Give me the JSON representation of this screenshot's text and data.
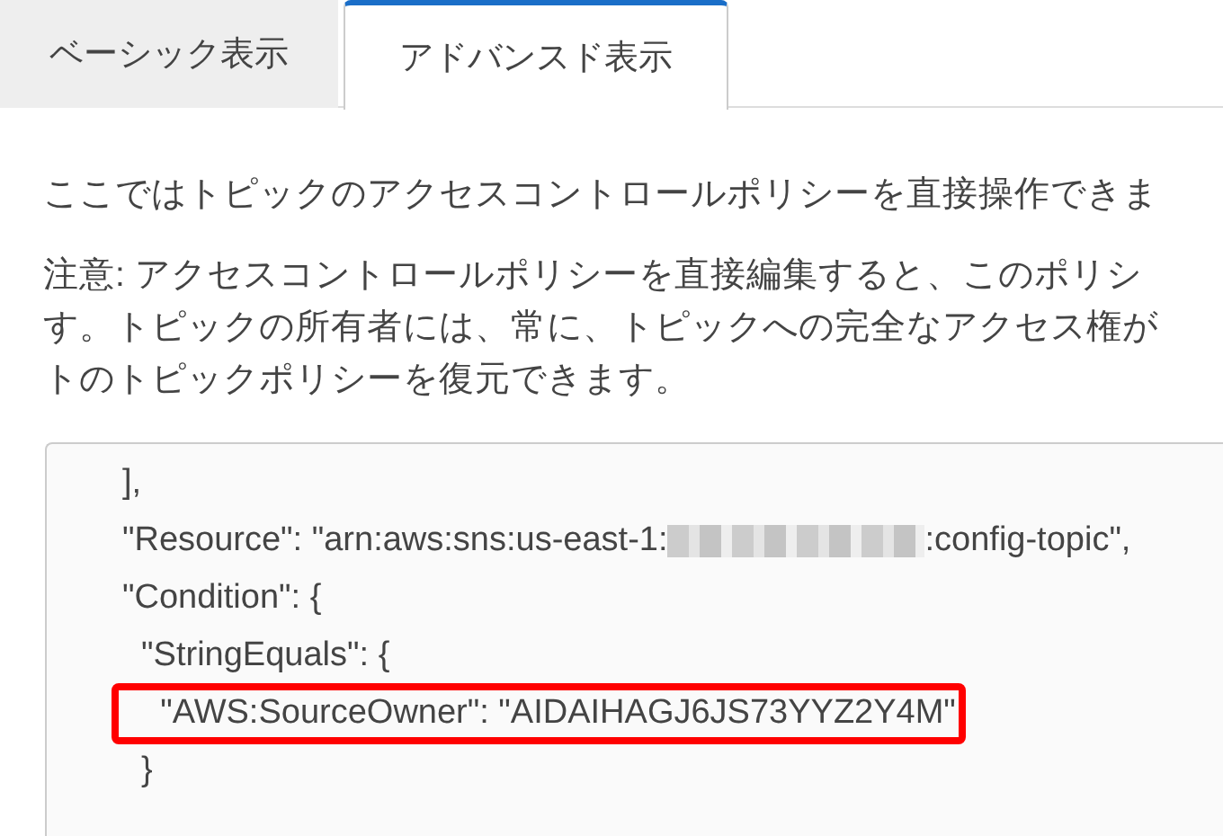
{
  "tabs": [
    {
      "label": "ベーシック表示",
      "selected": false
    },
    {
      "label": "アドバンスド表示",
      "selected": true
    }
  ],
  "intro": "ここではトピックのアクセスコントロールポリシーを直接操作できま",
  "note_lines": [
    "注意: アクセスコントロールポリシーを直接編集すると、このポリシ",
    "す。トピックの所有者には、常に、トピックへの完全なアクセス権が",
    "トのトピックポリシーを復元できます。"
  ],
  "policy_lines": [
    {
      "highlighted": false,
      "parts": [
        {
          "kind": "text",
          "text": "],"
        }
      ]
    },
    {
      "highlighted": false,
      "parts": [
        {
          "kind": "text",
          "text": "\"Resource\": \"arn:aws:sns:us-east-1:"
        },
        {
          "kind": "redacted"
        },
        {
          "kind": "text",
          "text": ":config-topic\","
        }
      ]
    },
    {
      "highlighted": false,
      "parts": [
        {
          "kind": "text",
          "text": "\"Condition\": {"
        }
      ]
    },
    {
      "highlighted": false,
      "parts": [
        {
          "kind": "text",
          "text": "  \"StringEquals\": {"
        }
      ]
    },
    {
      "highlighted": true,
      "parts": [
        {
          "kind": "text",
          "text": "    \"AWS:SourceOwner\": \"AIDAIHAGJ6JS73YYZ2Y4M\""
        }
      ]
    },
    {
      "highlighted": false,
      "parts": [
        {
          "kind": "text",
          "text": "  }"
        }
      ]
    }
  ]
}
